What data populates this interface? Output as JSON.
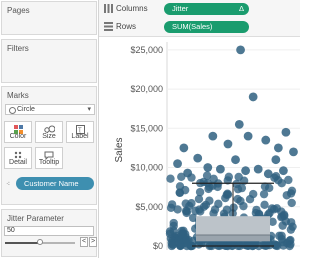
{
  "panels": {
    "pages": "Pages",
    "filters": "Filters",
    "marks": "Marks",
    "jitter": "Jitter Parameter"
  },
  "marks": {
    "mark_type": "Circle",
    "buttons": {
      "color": "Color",
      "size": "Size",
      "label": "Label",
      "detail": "Detail",
      "tooltip": "Tooltip"
    },
    "field_pill": "Customer Name"
  },
  "shelves": {
    "columns_label": "Columns",
    "columns_pill": "Jitter",
    "columns_pill_badge": "Δ",
    "rows_label": "Rows",
    "rows_pill": "SUM(Sales)"
  },
  "jitter": {
    "value": "50",
    "slider_fraction": 0.5,
    "prev": "<",
    "next": ">"
  },
  "chart_data": {
    "type": "scatter",
    "ylabel": "Sales",
    "ylim": [
      0,
      26000
    ],
    "yticks": [
      "$0",
      "$5,000",
      "$10,000",
      "$15,000",
      "$20,000",
      "$25,000"
    ],
    "ytick_values": [
      0,
      5000,
      10000,
      15000,
      20000,
      25000
    ],
    "mark_color": "#2f6080",
    "box": {
      "whisker_low": 0,
      "q1": 600,
      "median": 1400,
      "q3": 3800,
      "whisker_high": 8000
    },
    "outliers": [
      {
        "x": 0.56,
        "y": 25000
      },
      {
        "x": 0.66,
        "y": 19000
      },
      {
        "x": 0.62,
        "y": 14000
      },
      {
        "x": 0.76,
        "y": 13500
      },
      {
        "x": 0.55,
        "y": 15500
      },
      {
        "x": 0.92,
        "y": 14500
      },
      {
        "x": 0.46,
        "y": 13000
      },
      {
        "x": 0.34,
        "y": 14000
      },
      {
        "x": 0.86,
        "y": 12500
      },
      {
        "x": 0.11,
        "y": 12500
      },
      {
        "x": 0.22,
        "y": 11200
      },
      {
        "x": 0.06,
        "y": 10500
      },
      {
        "x": 0.52,
        "y": 11000
      },
      {
        "x": 0.84,
        "y": 11000
      },
      {
        "x": 0.3,
        "y": 10000
      },
      {
        "x": 0.7,
        "y": 9800
      },
      {
        "x": 0.98,
        "y": 12000
      },
      {
        "x": 0.4,
        "y": 9800
      },
      {
        "x": 0.6,
        "y": 9600
      },
      {
        "x": 0.9,
        "y": 9600
      },
      {
        "x": 0.14,
        "y": 9300
      },
      {
        "x": 0.78,
        "y": 9200
      }
    ]
  }
}
